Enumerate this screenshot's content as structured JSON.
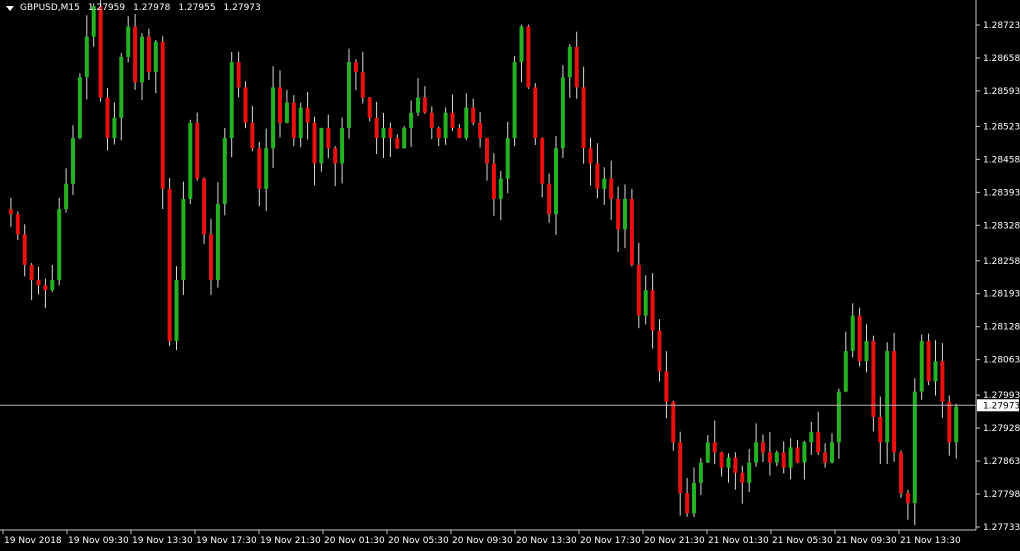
{
  "header": {
    "symbol": "GBPUSD,M15",
    "open": "1.27959",
    "high": "1.27978",
    "low": "1.27955",
    "close": "1.27973"
  },
  "colors": {
    "background": "#000000",
    "bull": "#22b222",
    "bear": "#e8110f",
    "axis": "#c8c8c8",
    "text": "#ffffff",
    "bid_line": "#b4b4b4"
  },
  "chart_data": {
    "type": "candlestick",
    "symbol": "GBPUSD",
    "timeframe": "M15",
    "current_price": 1.27973,
    "y_ticks": [
      1.28723,
      1.28658,
      1.28593,
      1.28523,
      1.28458,
      1.28393,
      1.28328,
      1.28258,
      1.28193,
      1.28128,
      1.28063,
      1.27993,
      1.27928,
      1.27863,
      1.27798,
      1.27733
    ],
    "current_price_label": "1.27973",
    "x_ticks": [
      "19 Nov 2018",
      "19 Nov 09:30",
      "19 Nov 13:30",
      "19 Nov 17:30",
      "19 Nov 21:30",
      "20 Nov 01:30",
      "20 Nov 05:30",
      "20 Nov 09:30",
      "20 Nov 13:30",
      "20 Nov 17:30",
      "20 Nov 21:30",
      "21 Nov 01:30",
      "21 Nov 05:30",
      "21 Nov 09:30",
      "21 Nov 13:30"
    ],
    "ylim": [
      1.2772,
      1.2878
    ],
    "close_path": [
      1.2836,
      1.2835,
      1.2831,
      1.2825,
      1.2822,
      1.2821,
      1.282,
      1.2822,
      1.2836,
      1.2841,
      1.285,
      1.2862,
      1.287,
      1.2876,
      1.2858,
      1.285,
      1.2854,
      1.2866,
      1.2872,
      1.2861,
      1.287,
      1.2863,
      1.2869,
      1.284,
      1.281,
      1.2822,
      1.2838,
      1.2853,
      1.2842,
      1.2831,
      1.2822,
      1.2837,
      1.285,
      1.2865,
      1.286,
      1.2853,
      1.2848,
      1.284,
      1.2848,
      1.286,
      1.2853,
      1.2857,
      1.285,
      1.2856,
      1.2853,
      1.2845,
      1.2852,
      1.2848,
      1.2845,
      1.2852,
      1.2865,
      1.2863,
      1.2858,
      1.2854,
      1.285,
      1.2852,
      1.285,
      1.2848,
      1.2852,
      1.2855,
      1.2858,
      1.2855,
      1.2852,
      1.285,
      1.2855,
      1.2852,
      1.285,
      1.2856,
      1.2853,
      1.285,
      1.2845,
      1.2838,
      1.2842,
      1.285,
      1.2865,
      1.2872,
      1.286,
      1.285,
      1.2841,
      1.2835,
      1.2848,
      1.2862,
      1.2868,
      1.286,
      1.2848,
      1.2845,
      1.284,
      1.2842,
      1.2838,
      1.2832,
      1.2838,
      1.2825,
      1.2815,
      1.282,
      1.2812,
      1.2804,
      1.2798,
      1.279,
      1.278,
      1.2776,
      1.2782,
      1.2786,
      1.279,
      1.2788,
      1.2785,
      1.2787,
      1.2784,
      1.2782,
      1.2786,
      1.279,
      1.2788,
      1.2786,
      1.2788,
      1.2785,
      1.2789,
      1.2786,
      1.279,
      1.2792,
      1.2788,
      1.2786,
      1.279,
      1.28,
      1.2808,
      1.2815,
      1.2806,
      1.281,
      1.2795,
      1.279,
      1.2808,
      1.2788,
      1.278,
      1.2778,
      1.28,
      1.281,
      1.2802,
      1.2806,
      1.2798,
      1.279,
      1.2797
    ]
  }
}
